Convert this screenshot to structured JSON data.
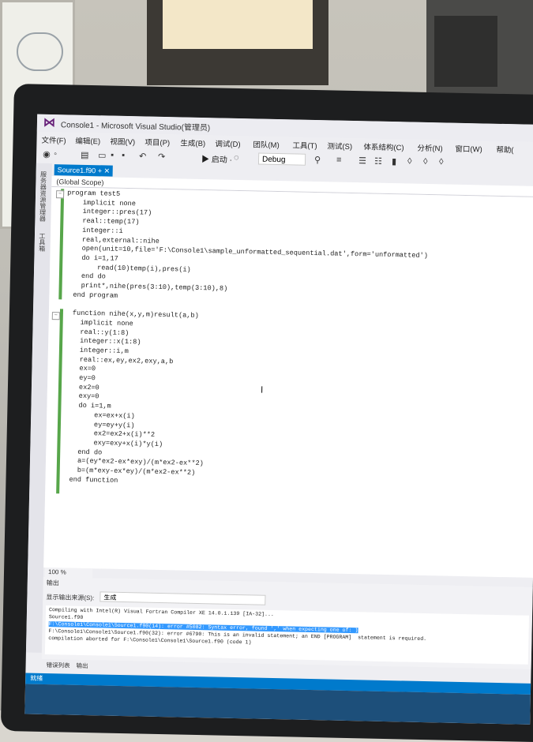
{
  "window": {
    "title": "Console1 - Microsoft Visual Studio(管理员)"
  },
  "menu": [
    "文件(F)",
    "编辑(E)",
    "视图(V)",
    "项目(P)",
    "生成(B)",
    "调试(D)",
    "团队(M)",
    "工具(T)",
    "测试(S)",
    "体系结构(C)",
    "分析(N)",
    "窗口(W)",
    "帮助("
  ],
  "toolbar": {
    "start_label": "▶ 启动 ·",
    "config": "Debug"
  },
  "sidebar": {
    "label1": "服务器资源管理器",
    "label2": "工具箱"
  },
  "editor": {
    "tab": "Source1.f90",
    "tab_pin": "+ ✕",
    "scope": "(Global Scope)",
    "zoom": "100 %"
  },
  "code": [
    {
      "text": "program test5",
      "indent": 0
    },
    {
      "text": "implicit none",
      "indent": 2
    },
    {
      "text": "integer::pres(17)",
      "indent": 2
    },
    {
      "text": "real::temp(17)",
      "indent": 2
    },
    {
      "text": "integer::i",
      "indent": 2
    },
    {
      "text": "real,external::nihe",
      "indent": 2
    },
    {
      "text": "open(unit=10,file='F:\\Console1\\sample_unformatted_sequential.dat',form='unformatted')",
      "indent": 2
    },
    {
      "text": "do i=1,17",
      "indent": 2
    },
    {
      "text": "read(10)temp(i),pres(i)",
      "indent": 4
    },
    {
      "text": "end do",
      "indent": 2
    },
    {
      "text": "print*,nihe(pres(3:10),temp(3:10),8)",
      "indent": 2
    },
    {
      "text": "end program",
      "indent": 1
    },
    {
      "text": "",
      "indent": 0
    },
    {
      "text": "function nihe(x,y,m)result(a,b)",
      "indent": 1
    },
    {
      "text": "implicit none",
      "indent": 2
    },
    {
      "text": "real::y(1:8)",
      "indent": 2
    },
    {
      "text": "integer::x(1:8)",
      "indent": 2
    },
    {
      "text": "integer::i,m",
      "indent": 2
    },
    {
      "text": "real::ex,ey,ex2,exy,a,b",
      "indent": 2
    },
    {
      "text": "ex=0",
      "indent": 2
    },
    {
      "text": "ey=0",
      "indent": 2
    },
    {
      "text": "ex2=0",
      "indent": 2
    },
    {
      "text": "exy=0",
      "indent": 2
    },
    {
      "text": "do i=1,m",
      "indent": 2
    },
    {
      "text": "ex=ex+x(i)",
      "indent": 4
    },
    {
      "text": "ey=ey+y(i)",
      "indent": 4
    },
    {
      "text": "ex2=ex2+x(i)**2",
      "indent": 4
    },
    {
      "text": "exy=exy+x(i)*y(i)",
      "indent": 4
    },
    {
      "text": "end do",
      "indent": 2
    },
    {
      "text": "a=(ey*ex2-ex*exy)/(m*ex2-ex**2)",
      "indent": 2
    },
    {
      "text": "b=(m*exy-ex*ey)/(m*ex2-ex**2)",
      "indent": 2
    },
    {
      "text": "end function",
      "indent": 1
    }
  ],
  "output": {
    "title": "输出",
    "source_label": "显示输出来源(S):",
    "source_value": "生成",
    "lines": [
      "Compiling with Intel(R) Visual Fortran Compiler XE 14.0.1.139 [IA-32]...",
      "Source1.f90",
      "F:\\Console1\\Console1\\Source1.f90(14): error #5082: Syntax error, found ',' when expecting one of: )",
      "F:\\Console1\\Console1\\Source1.f90(32): error #6790: This is an invalid statement; an END [PROGRAM]  statement is required.",
      "compilation aborted for F:\\Console1\\Console1\\Source1.f90 (code 1)"
    ]
  },
  "bottom_tabs": [
    "错误列表",
    "输出"
  ],
  "status": "就绪"
}
